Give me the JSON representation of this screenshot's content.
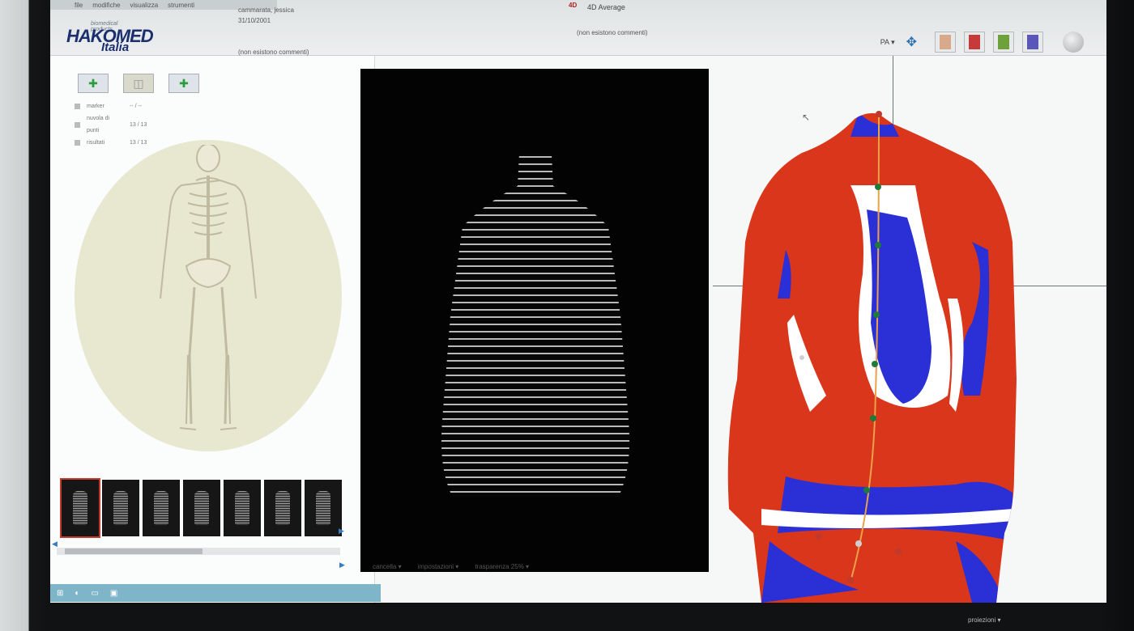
{
  "menu": {
    "items": [
      "file",
      "modifiche",
      "visualizza",
      "strumenti"
    ]
  },
  "logo": {
    "tagline": "biomedical products",
    "name": "HAKOMED",
    "sub": "Italia"
  },
  "patient": {
    "name": "cammarata, jessica",
    "date": "31/10/2001",
    "comment": "(non esistono commenti)"
  },
  "analysis": {
    "badge": "4D",
    "title": "4D Average",
    "comment": "(non esistono commenti)"
  },
  "viewbar": {
    "projection": "PA",
    "dropdown_icon": "chevron-down-icon"
  },
  "legend": {
    "rows": [
      {
        "label": "marker",
        "value": "-- / --"
      },
      {
        "label": "nuvola di punti",
        "value": "13 / 13"
      },
      {
        "label": "risultati",
        "value": "13 / 13"
      }
    ]
  },
  "bottombar": {
    "cancel": "cancella",
    "settings": "impostazioni",
    "transparency": "trasparenza 25%"
  },
  "footer": {
    "projections": "proiezioni"
  },
  "colors": {
    "accent_red": "#d9361c",
    "accent_blue": "#2a2fd6",
    "marker_green": "#1f7a3c",
    "logo_blue": "#1b2f6e"
  }
}
